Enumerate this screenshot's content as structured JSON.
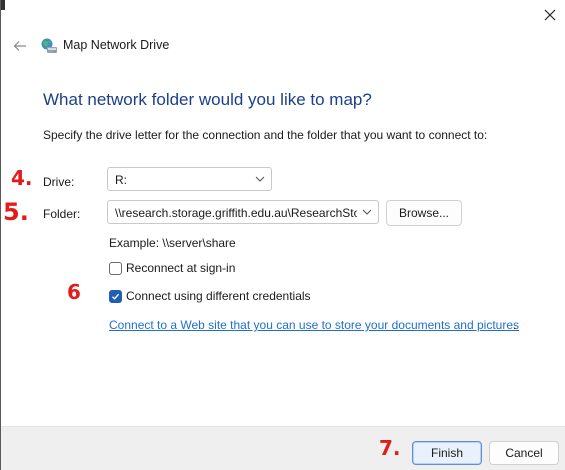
{
  "window": {
    "title": "Map Network Drive",
    "close_icon": "close-icon",
    "back_icon": "back-arrow-icon",
    "app_icon": "network-drive-icon"
  },
  "main": {
    "heading": "What network folder would you like to map?",
    "instructions": "Specify the drive letter for the connection and the folder that you want to connect to:",
    "drive": {
      "label": "Drive:",
      "value": "R:"
    },
    "folder": {
      "label": "Folder:",
      "value": "\\\\research.storage.griffith.edu.au\\ResearchSto",
      "browse_label": "Browse..."
    },
    "example": "Example: \\\\server\\share",
    "reconnect": {
      "label": "Reconnect at sign-in",
      "checked": false
    },
    "credentials": {
      "label": "Connect using different credentials",
      "checked": true
    },
    "link_text": "Connect to a Web site that you can use to store your documents and pictures",
    "link_suffix": "."
  },
  "footer": {
    "finish_label": "Finish",
    "cancel_label": "Cancel"
  },
  "annotations": {
    "drive": "4.",
    "folder": "5.",
    "credentials": "6",
    "finish": "7."
  },
  "colors": {
    "heading": "#1c3f8c",
    "link": "#1f6fd0",
    "checkbox_checked": "#1e5fb3",
    "annotation": "#e21c1c"
  }
}
